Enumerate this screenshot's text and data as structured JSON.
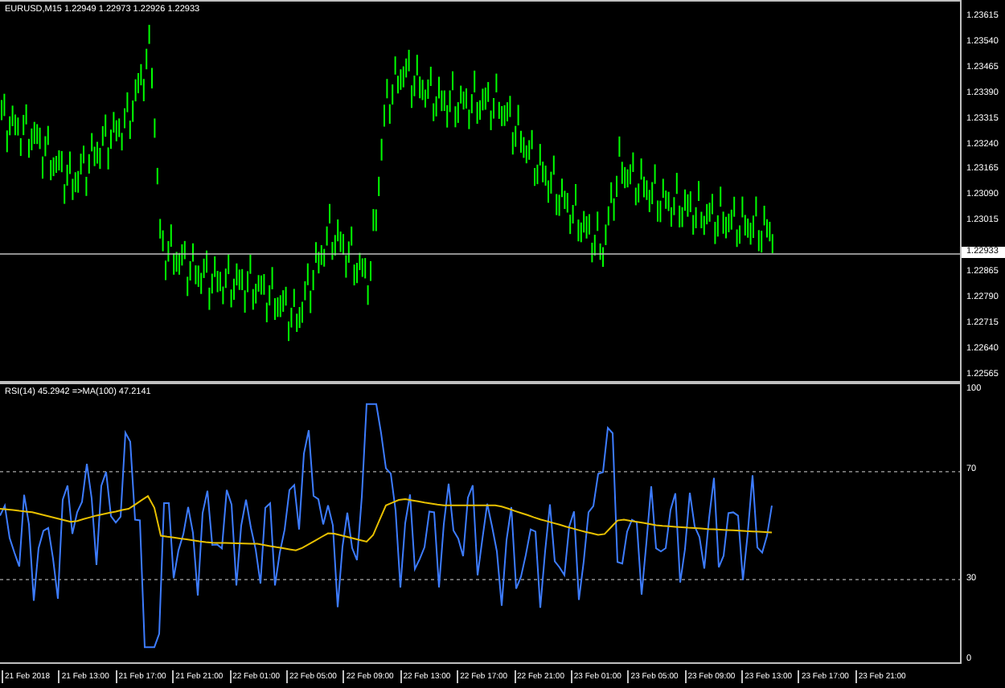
{
  "main_chart": {
    "title": "EURUSD,M15  1.22949 1.22973 1.22926 1.22933",
    "price_labels": [
      "1.23615",
      "1.23540",
      "1.23465",
      "1.23390",
      "1.23315",
      "1.23240",
      "1.23165",
      "1.23090",
      "1.23015",
      "1.22865",
      "1.22790",
      "1.22715",
      "1.22640",
      "1.22565"
    ],
    "current_price": "1.22933"
  },
  "rsi_panel": {
    "title": "RSI(14) 45.2942  =>MA(100) 47.2141",
    "level_labels": [
      "100",
      "70",
      "30",
      "0"
    ]
  },
  "time_axis": [
    "21 Feb 2018",
    "21 Feb 13:00",
    "21 Feb 17:00",
    "21 Feb 21:00",
    "22 Feb 01:00",
    "22 Feb 05:00",
    "22 Feb 09:00",
    "22 Feb 13:00",
    "22 Feb 17:00",
    "22 Feb 21:00",
    "23 Feb 01:00",
    "23 Feb 05:00",
    "23 Feb 09:00",
    "23 Feb 13:00",
    "23 Feb 17:00",
    "23 Feb 21:00"
  ]
}
